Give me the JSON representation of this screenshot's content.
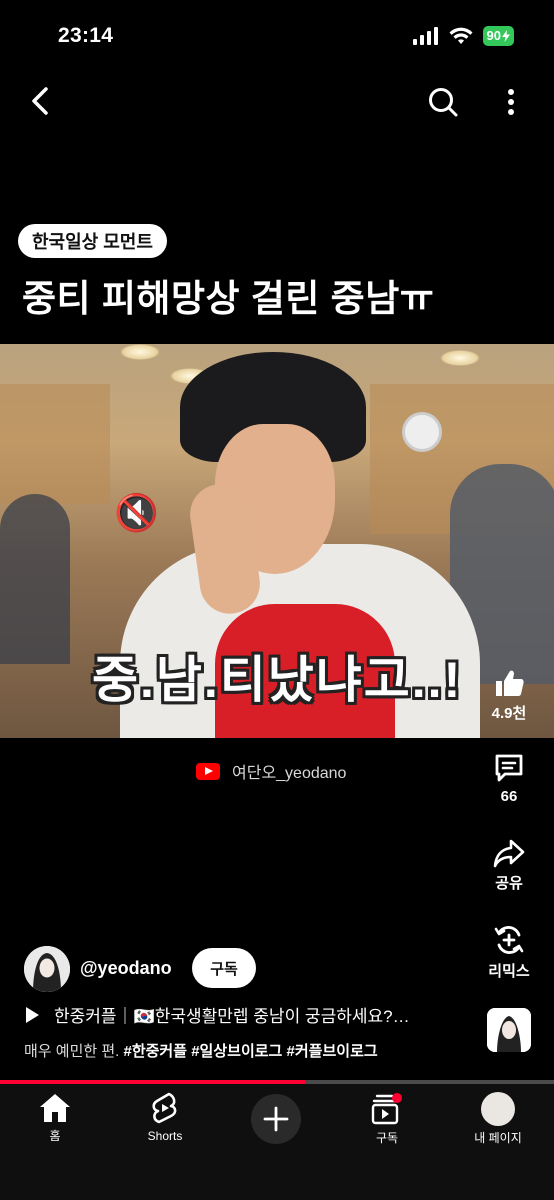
{
  "status_bar": {
    "time": "23:14",
    "battery": "90"
  },
  "top_nav": {
    "back": "back-icon",
    "search": "search-icon",
    "more": "more-vertical-icon"
  },
  "video": {
    "tag": "한국일상 모먼트",
    "title": "중티 피해망상 걸린 중남ㅠ",
    "caption": "중.남.티났냐고..!",
    "speaker_emoji": "🔇"
  },
  "watermark": {
    "channel": "여단오_yeodano"
  },
  "actions": {
    "like_count": "4.9천",
    "comment_count": "66",
    "share_label": "공유",
    "remix_label": "리믹스"
  },
  "channel": {
    "handle": "@yeodano",
    "subscribe_label": "구독"
  },
  "playlist": {
    "text": "한중커플｜🇰🇷한국생활만렙 중남이 궁금하세요?…"
  },
  "description": {
    "plain": "매우 예민한 편.",
    "hashtags": [
      "#한중커플",
      "#일상브이로그",
      "#커플브이로그"
    ]
  },
  "progress": {
    "played_fraction": 0.55
  },
  "bottom_nav": {
    "home": "홈",
    "shorts": "Shorts",
    "subscriptions": "구독",
    "my_page": "내 페이지"
  },
  "colors": {
    "accent": "#ff0033",
    "battery": "#34c759",
    "apron": "#d81e26"
  }
}
